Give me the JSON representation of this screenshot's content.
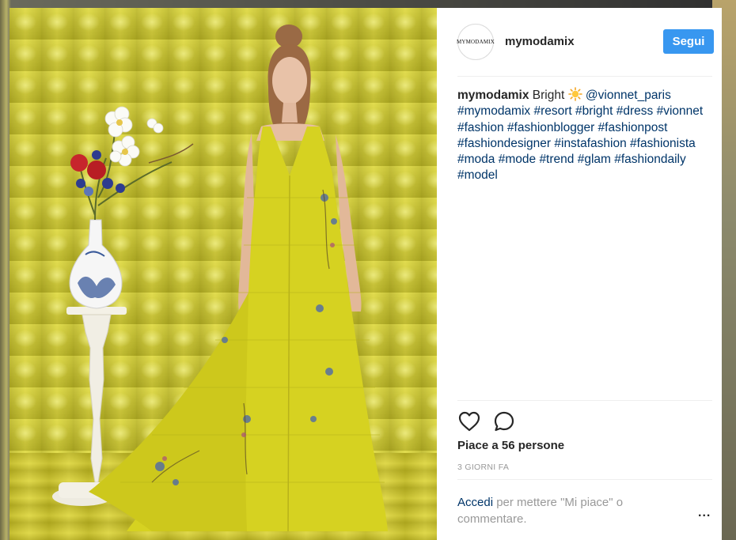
{
  "post": {
    "username": "mymodamix",
    "avatar_text": "MYMODAMIX",
    "follow_label": "Segui",
    "caption_username": "mymodamix",
    "caption_word": "Bright",
    "caption_emoji": "sun-emoji",
    "caption_mention": "@vionnet_paris",
    "hashtags": [
      "#mymodamix",
      "#resort",
      "#bright",
      "#dress",
      "#vionnet",
      "#fashion",
      "#fashionblogger",
      "#fashionpost",
      "#fashiondesigner",
      "#instafashion",
      "#fashionista",
      "#moda",
      "#mode",
      "#trend",
      "#glam",
      "#fashiondaily",
      "#model"
    ],
    "likes_text": "Piace a 56 persone",
    "time_text": "3 GIORNI FA",
    "login_link": "Accedi",
    "login_rest": "per mettere \"Mi piace\" o commentare.",
    "more_label": "..."
  },
  "icons": {
    "like": "heart-outline-icon",
    "comment": "comment-bubble-icon",
    "more": "more-options-icon"
  },
  "colors": {
    "follow_button": "#3897f0",
    "link": "#003569",
    "photo_background": "#dcd62a"
  }
}
